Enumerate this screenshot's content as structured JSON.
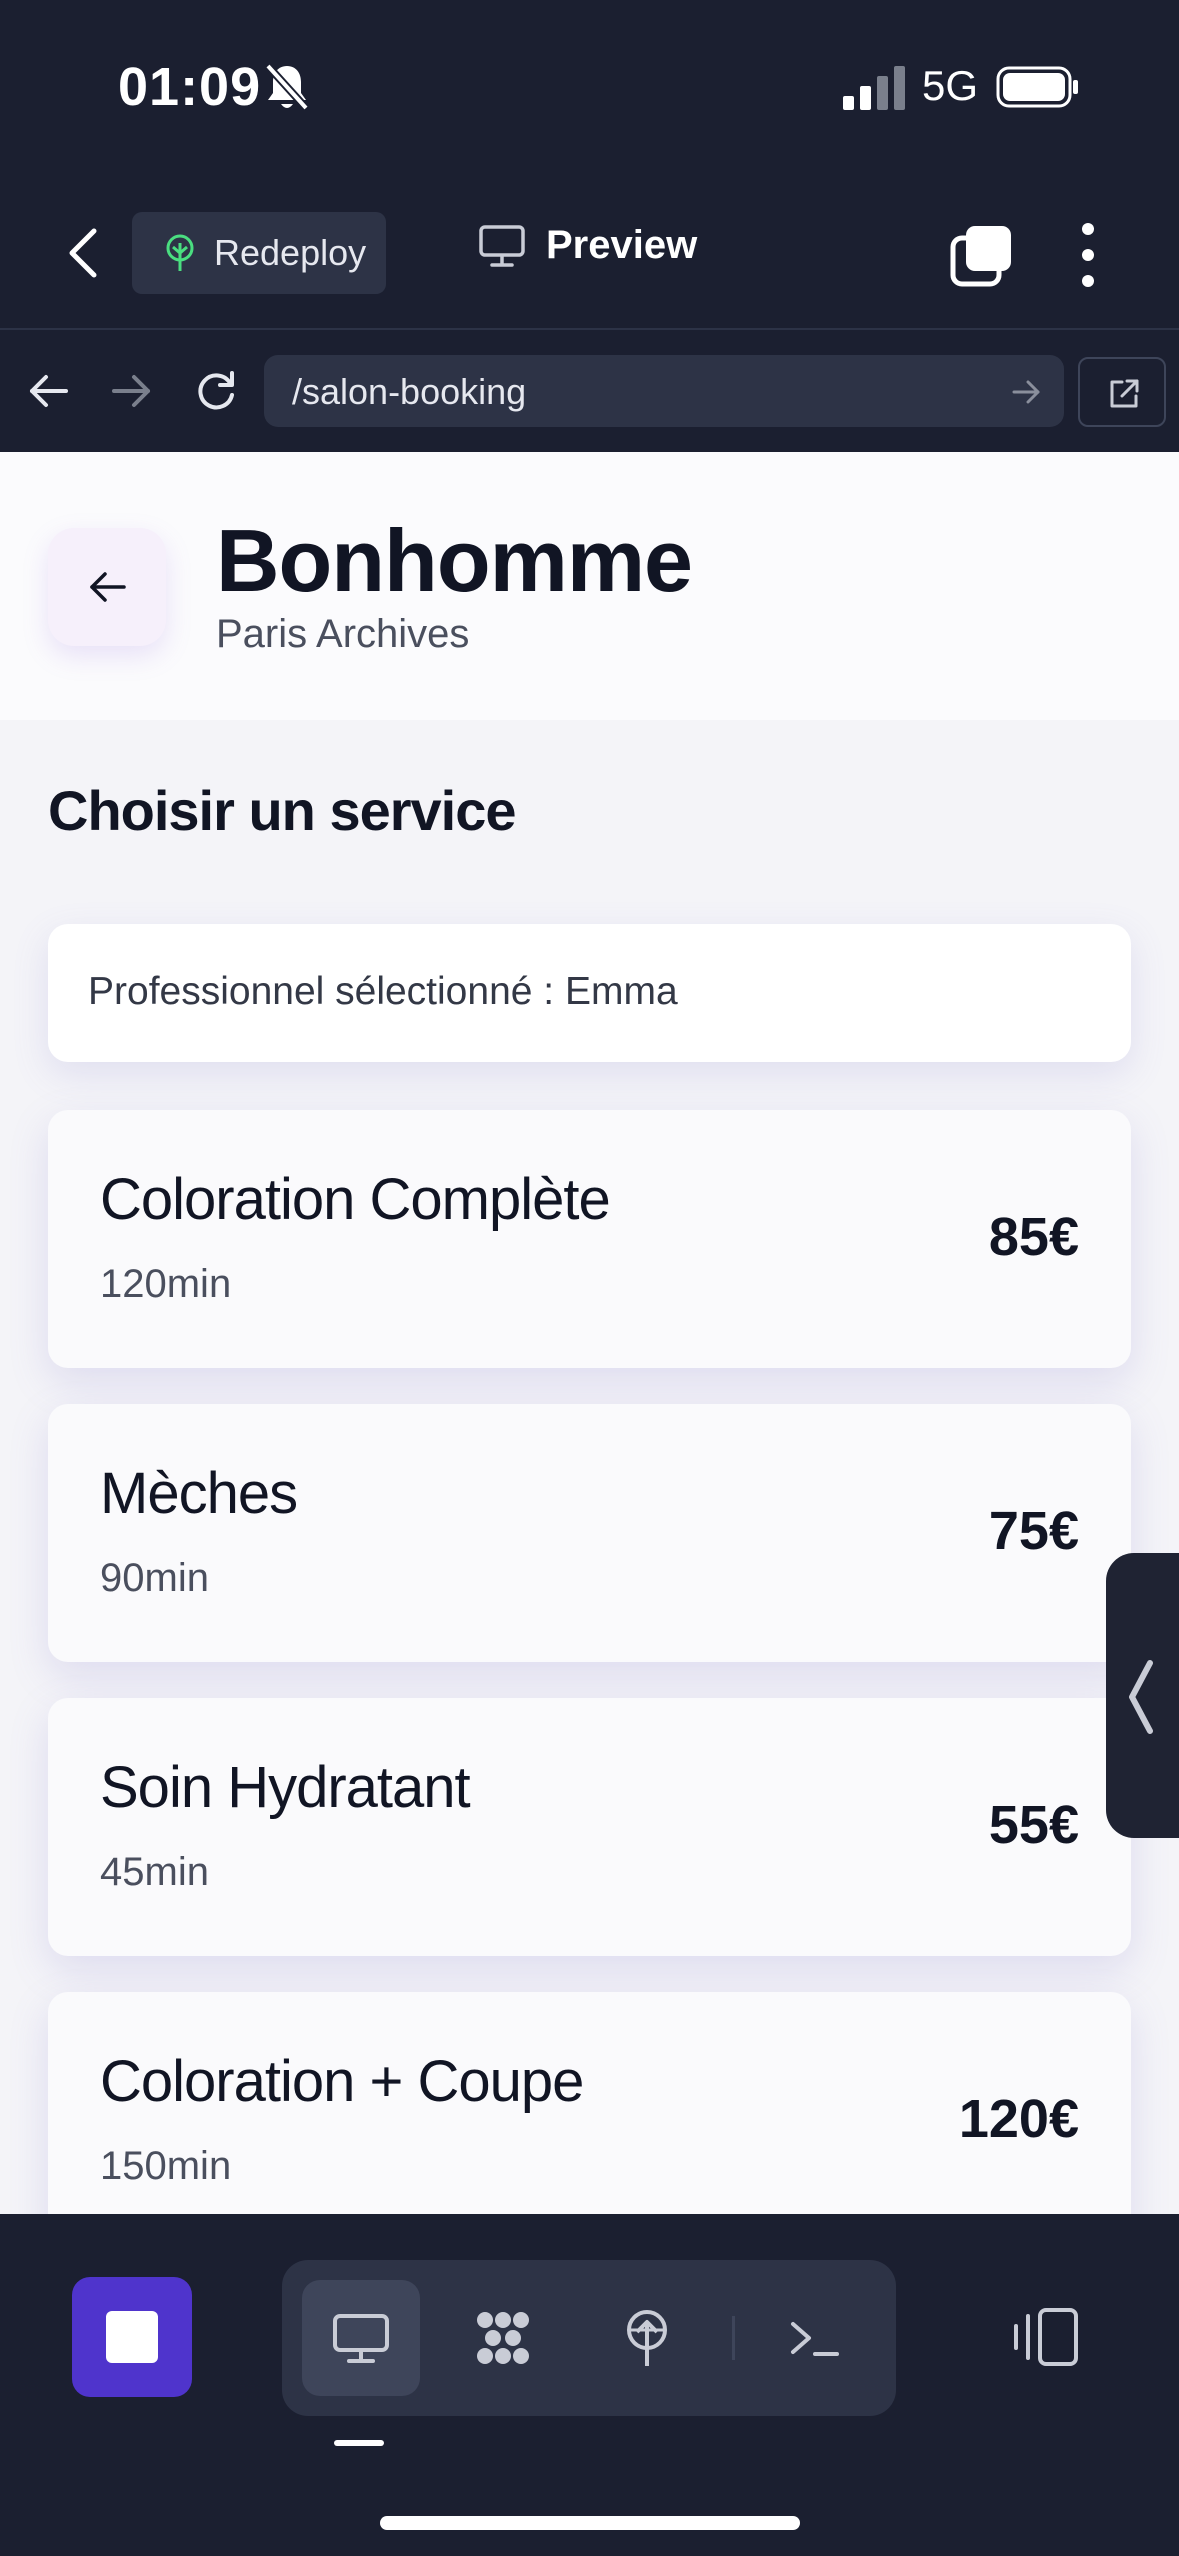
{
  "status_bar": {
    "time": "01:09",
    "network": "5G"
  },
  "app_bar": {
    "redeploy_label": "Redeploy",
    "preview_label": "Preview"
  },
  "browser": {
    "url": "/salon-booking"
  },
  "page": {
    "shop_name": "Bonhomme",
    "shop_location": "Paris Archives",
    "section_title": "Choisir un service",
    "selected_professional": "Professionnel sélectionné : Emma",
    "services": [
      {
        "name": "Coloration Complète",
        "duration": "120min",
        "price": "85€"
      },
      {
        "name": "Mèches",
        "duration": "90min",
        "price": "75€"
      },
      {
        "name": "Soin Hydratant",
        "duration": "45min",
        "price": "55€"
      },
      {
        "name": "Coloration + Coupe",
        "duration": "150min",
        "price": "120€"
      }
    ]
  },
  "colors": {
    "accent": "#4f34cc",
    "dark_bg": "#1b1f30",
    "deploy_icon": "#4ade80"
  },
  "icons": [
    "bell-slash-icon",
    "signal-icon",
    "battery-icon",
    "chevron-left-icon",
    "tree-icon",
    "monitor-icon",
    "tabs-icon",
    "more-vertical-icon",
    "arrow-left-icon",
    "arrow-right-icon",
    "reload-icon",
    "external-link-icon",
    "stop-icon",
    "nodes-icon",
    "deploy-icon",
    "terminal-icon",
    "panel-icon"
  ]
}
